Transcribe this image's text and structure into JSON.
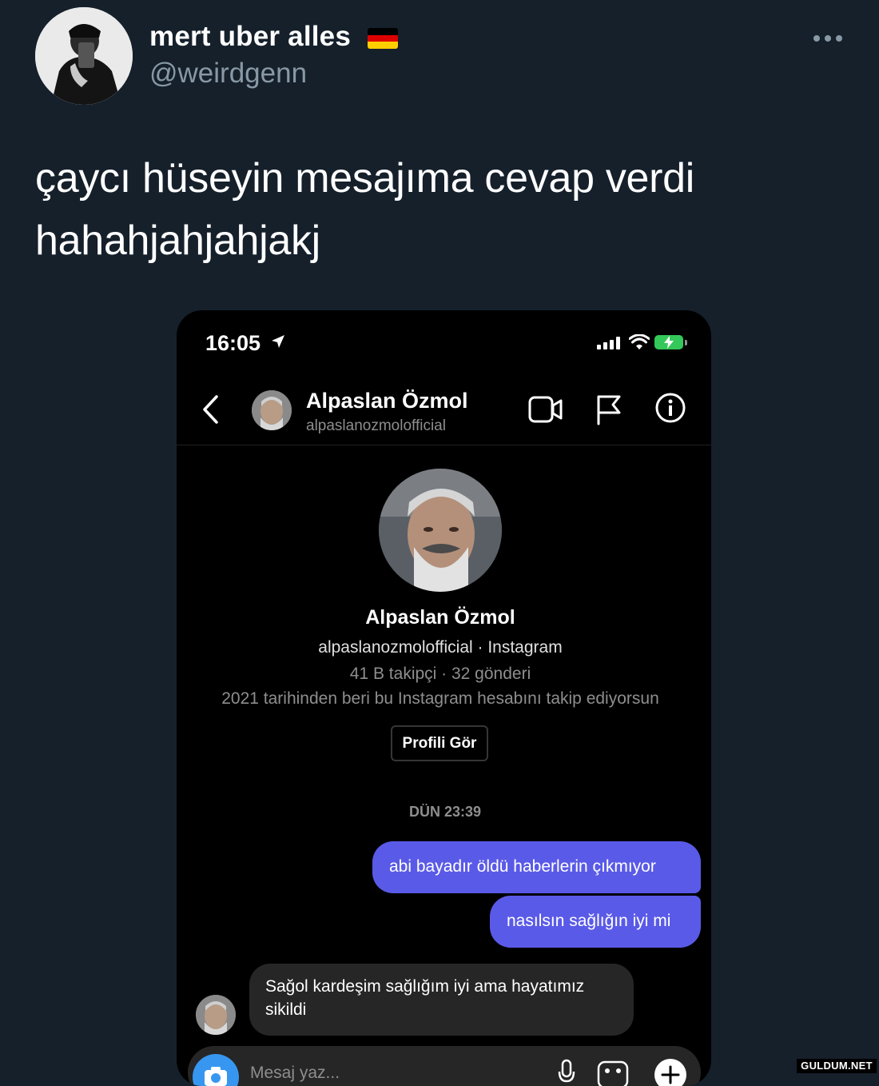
{
  "tweet": {
    "display_name": "mert uber alles",
    "handle": "@weirdgenn",
    "text_lines": [
      "çaycı hüseyin mesajıma cevap verdi",
      "hahahjahjahjakj"
    ],
    "flag_emoji": "🇩🇪",
    "more_icon": "more-dots-icon"
  },
  "phone": {
    "status": {
      "time": "16:05"
    },
    "header": {
      "name": "Alpaslan Özmol",
      "username": "alpaslanozmolofficial"
    },
    "profile": {
      "name": "Alpaslan Özmol",
      "username_line": "alpaslanozmolofficial · Instagram",
      "stats": "41 B takipçi · 32 gönderi",
      "follow_note": "2021 tarihinden beri bu Instagram hesabını takip ediyorsun",
      "view_profile_button": "Profili Gör"
    },
    "chat": {
      "timestamp": "DÜN 23:39",
      "outgoing": [
        "abi bayadır öldü haberlerin çıkmıyor",
        "nasılsın sağlığın iyi mi"
      ],
      "incoming_lines": [
        "Sağol kardeşim sağlığım iyi ama hayatımız",
        "sikildi"
      ]
    },
    "composer": {
      "placeholder": "Mesaj yaz..."
    }
  },
  "watermark": "GULDUM.NET",
  "colors": {
    "background": "#15202b",
    "secondary_text": "#8899a6",
    "outgoing_bubble": "#5a5ae8",
    "incoming_bubble": "#262626",
    "camera_button": "#3797f0"
  }
}
